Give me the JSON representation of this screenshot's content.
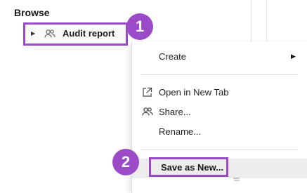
{
  "browse": {
    "title": "Browse",
    "item": {
      "label": "Audit report",
      "icon": "users-icon",
      "expander_icon": "triangle-right-icon"
    }
  },
  "annotations": {
    "step1": "1",
    "step2": "2",
    "highlight_color": "#9b4bc8"
  },
  "context_menu": {
    "items": [
      {
        "label": "Create",
        "icon": "",
        "has_submenu": true
      },
      {
        "label": "Open in New Tab",
        "icon": "external-link-icon"
      },
      {
        "label": "Share...",
        "icon": "users-icon"
      },
      {
        "label": "Rename...",
        "icon": ""
      },
      {
        "label": "Save as New...",
        "icon": "",
        "highlighted": true
      }
    ]
  }
}
